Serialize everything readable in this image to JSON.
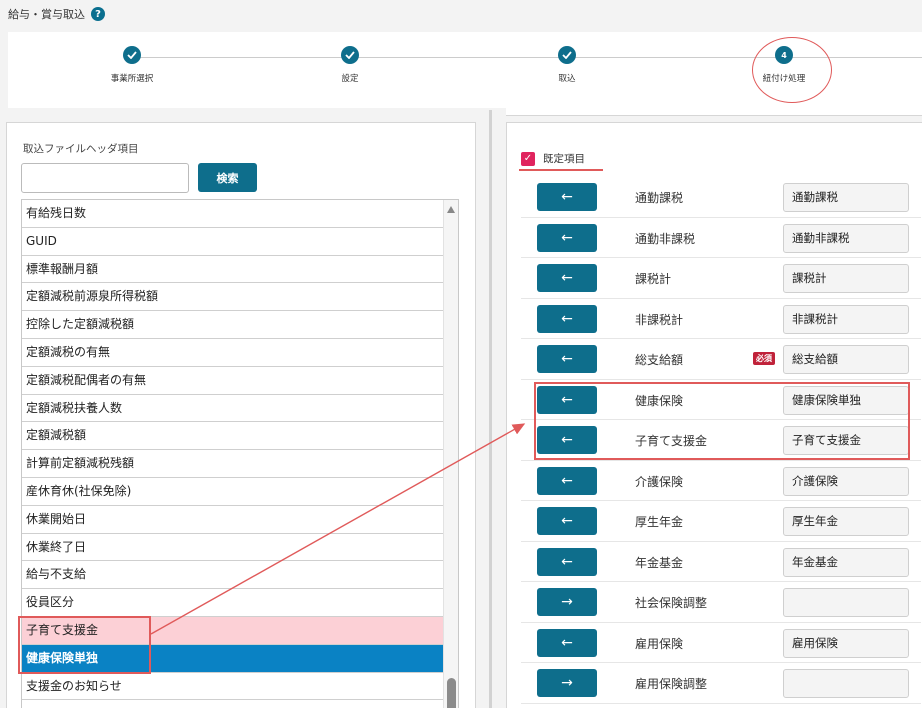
{
  "page": {
    "title": "給与・賞与取込",
    "help_icon": "?"
  },
  "stepper": {
    "steps": [
      {
        "label": "事業所選択",
        "state": "done"
      },
      {
        "label": "設定",
        "state": "done"
      },
      {
        "label": "取込",
        "state": "done"
      },
      {
        "label": "紐付け処理",
        "state": "current",
        "number": "4"
      }
    ]
  },
  "left": {
    "title": "取込ファイルヘッダ項目",
    "search": {
      "value": "",
      "button_label": "検索"
    },
    "items": [
      "有給残日数",
      "GUID",
      "標準報酬月額",
      "定額減税前源泉所得税額",
      "控除した定額減税額",
      "定額減税の有無",
      "定額減税配偶者の有無",
      "定額減税扶養人数",
      "定額減税額",
      "計算前定額減税残額",
      "産休育休(社保免除)",
      "休業開始日",
      "休業終了日",
      "給与不支給",
      "役員区分",
      "子育て支援金",
      "健康保険単独",
      "支援金のお知らせ"
    ],
    "highlighted_item_index": 15,
    "selected_item_index": 16
  },
  "right": {
    "default_items_label": "既定項目",
    "default_items_checked": true,
    "required_badge": "必須",
    "rows": [
      {
        "arrow": "←",
        "label": "通勤課税",
        "value": "通勤課税",
        "required": false
      },
      {
        "arrow": "←",
        "label": "通勤非課税",
        "value": "通勤非課税",
        "required": false
      },
      {
        "arrow": "←",
        "label": "課税計",
        "value": "課税計",
        "required": false
      },
      {
        "arrow": "←",
        "label": "非課税計",
        "value": "非課税計",
        "required": false
      },
      {
        "arrow": "←",
        "label": "総支給額",
        "value": "総支給額",
        "required": true
      },
      {
        "arrow": "←",
        "label": "健康保険",
        "value": "健康保険単独",
        "required": false
      },
      {
        "arrow": "←",
        "label": "子育て支援金",
        "value": "子育て支援金",
        "required": false
      },
      {
        "arrow": "←",
        "label": "介護保険",
        "value": "介護保険",
        "required": false
      },
      {
        "arrow": "←",
        "label": "厚生年金",
        "value": "厚生年金",
        "required": false
      },
      {
        "arrow": "←",
        "label": "年金基金",
        "value": "年金基金",
        "required": false
      },
      {
        "arrow": "→",
        "label": "社会保険調整",
        "value": "",
        "required": false
      },
      {
        "arrow": "←",
        "label": "雇用保険",
        "value": "雇用保険",
        "required": false
      },
      {
        "arrow": "→",
        "label": "雇用保険調整",
        "value": "",
        "required": false
      }
    ]
  },
  "colors": {
    "primary": "#0e6e8c",
    "selected_row": "#0a82c4",
    "highlight_row": "#fcd0d6",
    "annotation_red": "#e05a5a",
    "required_badge": "#c0223a",
    "checkbox": "#e0245e"
  }
}
